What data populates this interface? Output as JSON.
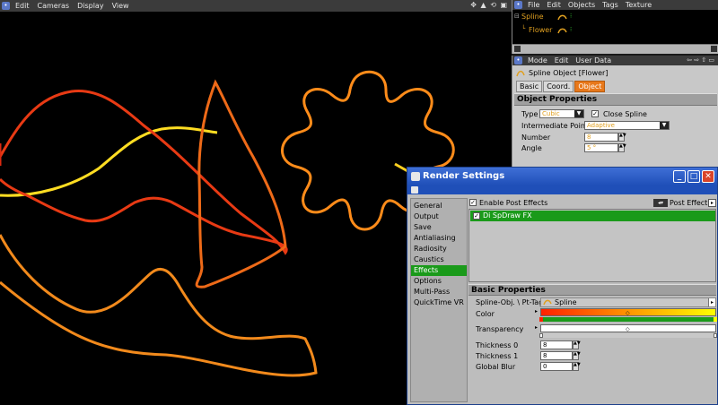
{
  "viewport": {
    "menu": [
      "Edit",
      "Cameras",
      "Display",
      "View"
    ],
    "nav_icons": "✥ ▲ ⟲ ▣"
  },
  "object_manager": {
    "menu": [
      "File",
      "Edit",
      "Objects",
      "Tags",
      "Texture"
    ],
    "objects": [
      {
        "name": "Spline",
        "color": "#e0a020"
      },
      {
        "name": "Flower",
        "color": "#e0a020"
      }
    ]
  },
  "attribute_manager": {
    "menu": [
      "Mode",
      "Edit",
      "User Data"
    ],
    "title": "Spline Object [Flower]",
    "tabs": [
      "Basic",
      "Coord.",
      "Object"
    ],
    "active_tab": "Object",
    "section": "Object Properties",
    "type_label": "Type",
    "type_value": "Cubic",
    "close_spline_label": "Close Spline",
    "close_spline_checked": true,
    "intermediate_label": "Intermediate Points",
    "intermediate_value": "Adaptive",
    "number_label": "Number",
    "number_value": "8",
    "angle_label": "Angle",
    "angle_value": "5 °"
  },
  "render_settings": {
    "title": "Render Settings",
    "sidebar": [
      "General",
      "Output",
      "Save",
      "Antialiasing",
      "Radiosity",
      "Caustics",
      "Effects",
      "Options",
      "Multi-Pass",
      "QuickTime VR"
    ],
    "active_item": "Effects",
    "enable_post_effects_label": "Enable Post Effects",
    "enable_post_effects_checked": true,
    "post_effect_button": "Post Effect",
    "post_effects": [
      {
        "name": "Di SpDraw FX",
        "enabled": true
      }
    ],
    "basic_properties": "Basic Properties",
    "spline_obj_label": "Spline-Obj. \\ Pt-Tag",
    "spline_obj_value": "Spline",
    "color_label": "Color",
    "transparency_label": "Transparency",
    "thickness0_label": "Thickness 0",
    "thickness0_value": "8",
    "thickness1_label": "Thickness 1",
    "thickness1_value": "8",
    "global_blur_label": "Global Blur",
    "global_blur_value": "0",
    "colors": {
      "accent": "#1a9a1a",
      "title_bar": "#2c5cc5",
      "gradient_start": "#ff2000",
      "gradient_end": "#ffff00"
    }
  }
}
